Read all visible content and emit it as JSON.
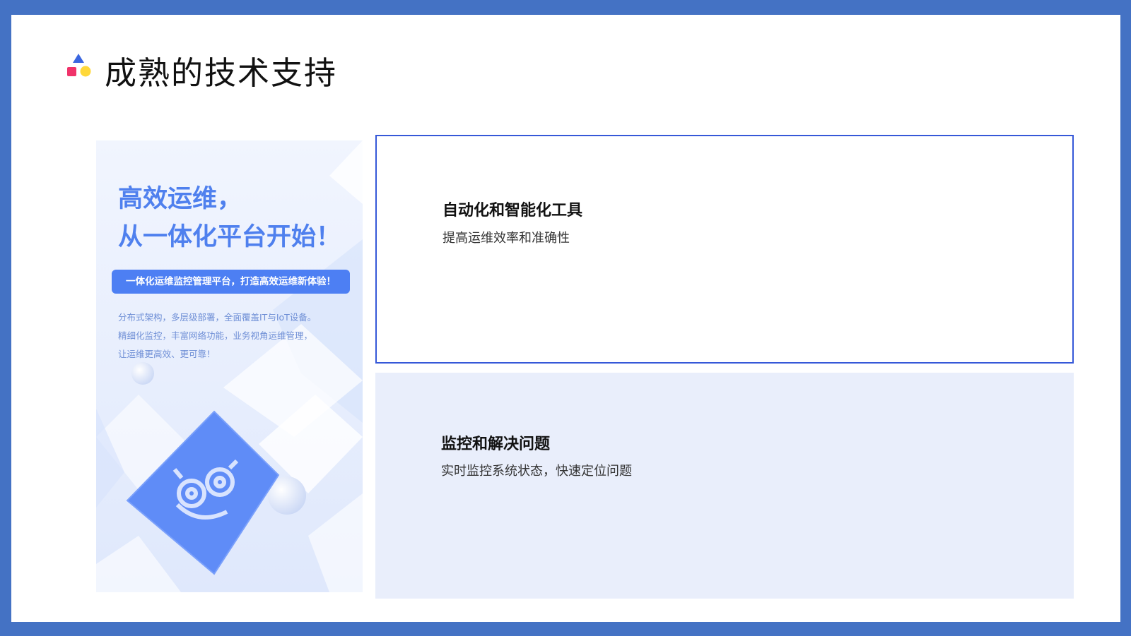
{
  "slide": {
    "title": "成熟的技术支持"
  },
  "poster": {
    "headline_line1": "高效运维，",
    "headline_line2": "从一体化平台开始！",
    "banner": "一体化运维监控管理平台，打造高效运维新体验！",
    "desc_lines": [
      "分布式架构，多层级部署，全面覆盖IT与IoT设备。",
      "精细化监控，丰富网络功能，业务视角运维管理，",
      "让运维更高效、更可靠！"
    ]
  },
  "cards": [
    {
      "title": "自动化和智能化工具",
      "subtitle": "提高运维效率和准确性"
    },
    {
      "title": "监控和解决问题",
      "subtitle": "实时监控系统状态，快速定位问题"
    }
  ],
  "colors": {
    "frame": "#4472C4",
    "accent_blue": "#4d7ff3",
    "card_border": "#3658d8",
    "card_fill": "#e9eefb"
  },
  "icons": {
    "logo": "shapes-logo-icon",
    "poster_mascot": "owl-mascot-icon"
  }
}
